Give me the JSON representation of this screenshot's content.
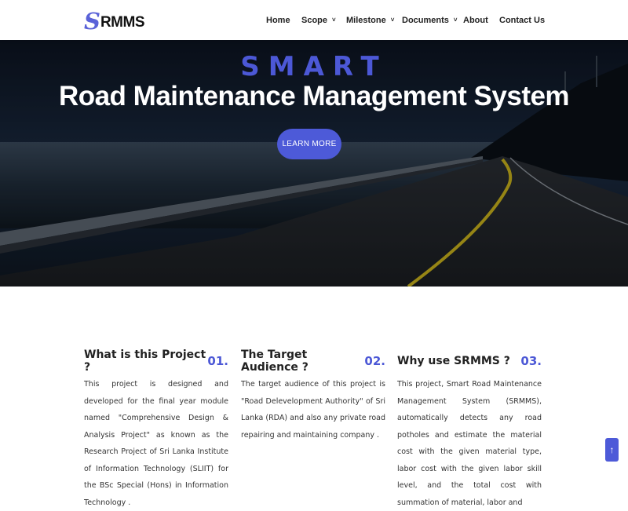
{
  "brand": {
    "logo_initial": "S",
    "logo_rest": "RMMS"
  },
  "nav": {
    "home": "Home",
    "scope": "Scope",
    "milestone": "Milestone",
    "documents": "Documents",
    "about": "About",
    "contact": "Contact Us",
    "dropdown_caret": "˅"
  },
  "hero": {
    "tagline": "SMART",
    "title": "Road Maintenance Management System",
    "cta_label": "LEARN MORE"
  },
  "features": [
    {
      "title": "What is this Project ?",
      "number": "01.",
      "text": "This project is designed and developed for the final year module named \"Comprehensive Design & Analysis Project\" as known as the Research Project of Sri Lanka Institute of Information Technology (SLIIT) for the BSc Special (Hons) in Information Technology ."
    },
    {
      "title": "The Target Audience ?",
      "number": "02.",
      "text": "The target audience of this project is \"Road Delevelopment Authority\" of Sri Lanka (RDA) and also any private road repairing and maintaining company ."
    },
    {
      "title": "Why use SRMMS ?",
      "number": "03.",
      "text": "This project, Smart Road Maintenance Management System (SRMMS), automatically detects any road potholes and estimate the material cost with the given material type, labor cost with the given labor skill level, and the total cost with summation of material, labor and"
    }
  ],
  "back_to_top": {
    "icon": "arrow-up-icon",
    "glyph": "↑"
  },
  "colors": {
    "accent": "#4d5ad8",
    "text": "#222222",
    "hero_bg": "#142031"
  }
}
